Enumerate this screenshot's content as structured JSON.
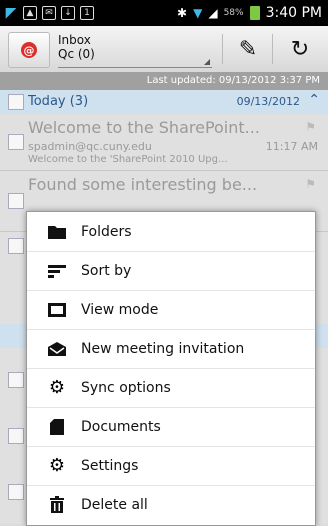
{
  "status_bar": {
    "battery": "58%",
    "time": "3:40 PM"
  },
  "account": {
    "name": "Inbox",
    "folder": "Qc (0)"
  },
  "last_updated": "Last updated: 09/13/2012 3:37 PM",
  "group": {
    "label": "Today (3)",
    "date": "09/13/2012"
  },
  "mails": [
    {
      "subject": "Welcome to the SharePoint...",
      "from": "spadmin@qc.cuny.edu",
      "time": "11:17 AM",
      "preview": "Welcome to the 'SharePoint 2010 Upg..."
    },
    {
      "subject": "Found some interesting be...",
      "from": "",
      "time": "",
      "preview": ""
    }
  ],
  "menu": [
    {
      "label": "Folders",
      "icon": "folder-icon"
    },
    {
      "label": "Sort by",
      "icon": "sort-icon"
    },
    {
      "label": "View mode",
      "icon": "view-mode-icon"
    },
    {
      "label": "New meeting invitation",
      "icon": "envelope-icon"
    },
    {
      "label": "Sync options",
      "icon": "gear-icon"
    },
    {
      "label": "Documents",
      "icon": "document-icon"
    },
    {
      "label": "Settings",
      "icon": "gear-icon"
    },
    {
      "label": "Delete all",
      "icon": "trash-icon"
    }
  ]
}
